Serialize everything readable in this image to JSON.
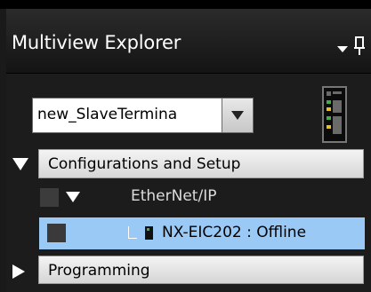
{
  "panel": {
    "title": "Multiview Explorer",
    "pin_icon": "pin-icon",
    "menu_icon": "chevron-down-icon"
  },
  "dropdown": {
    "selected": "new_SlaveTermina"
  },
  "tree": {
    "categories": [
      {
        "label": "Configurations and Setup",
        "expanded": true
      },
      {
        "label": "Programming",
        "expanded": false
      }
    ],
    "items": [
      {
        "label": "EtherNet/IP",
        "expanded": true
      },
      {
        "label": "NX-EIC202 : Offline",
        "selected": true
      }
    ]
  },
  "colors": {
    "selection": "#99c9f4",
    "panel_bg": "#1c1c1c"
  }
}
